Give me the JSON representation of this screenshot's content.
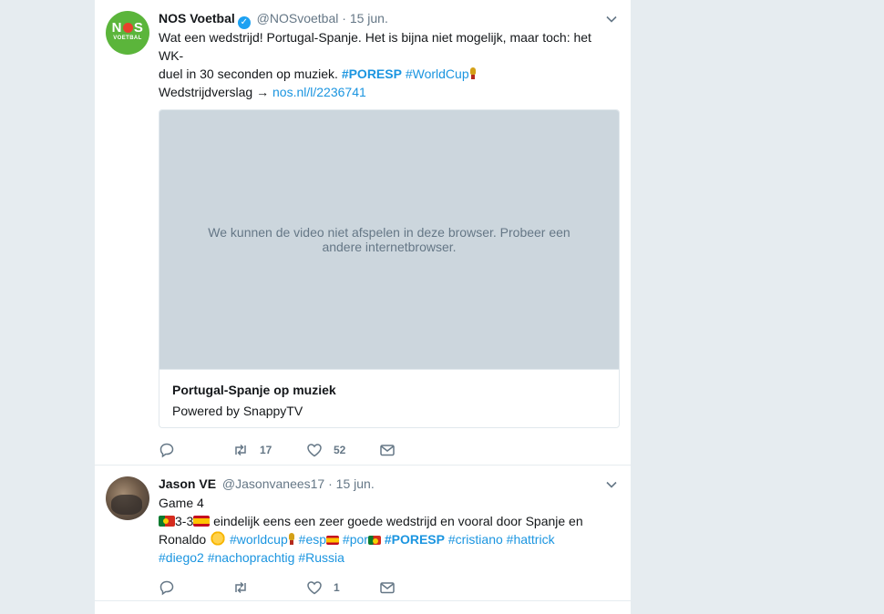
{
  "tweets": [
    {
      "author_name": "NOS Voetbal",
      "handle": "@NOSvoetbal",
      "separator": "·",
      "time": "15 jun.",
      "avatar_text": "NOS",
      "avatar_subtext": "VOETBAL",
      "text_line1": "Wat een wedstrijd! Portugal-Spanje. Het is bijna niet mogelijk, maar toch: het WK-",
      "text_line2": "duel in 30 seconden op muziek.",
      "hashtag1": "#PORESP",
      "hashtag2": "#WorldCup",
      "report_label": "Wedstrijdverslag →",
      "report_link": "nos.nl/l/2236741",
      "card": {
        "video_message": "We kunnen de video niet afspelen in deze browser. Probeer een andere internetbrowser.",
        "title": "Portugal-Spanje op muziek",
        "subtitle": "Powered by SnappyTV"
      },
      "retweets": "17",
      "likes": "52"
    },
    {
      "author_name": "Jason VE",
      "handle": "@Jasonvanees17",
      "separator": "·",
      "time": "15 jun.",
      "line1": "Game 4",
      "score": "3-3",
      "line2_text": "eindelijk eens een zeer goede wedstrijd en vooral door Spanje en",
      "line3_text": "Ronaldo",
      "tags_line3": [
        "#worldcup",
        "#esp",
        "#por",
        "#PORESP",
        "#cristiano",
        "#hattrick"
      ],
      "tags_line4": [
        "#diego2",
        "#nachoprachtig",
        "#Russia"
      ],
      "retweets": "",
      "likes": "1"
    }
  ],
  "colors": {
    "link": "#1b95e0",
    "muted": "#657786",
    "nos_green": "#5bb53b",
    "nos_red": "#e8412c",
    "verified": "#1da1f2"
  },
  "icons": [
    "reply-icon",
    "retweet-icon",
    "like-icon",
    "message-icon",
    "chevron-down-icon",
    "verified-icon"
  ]
}
